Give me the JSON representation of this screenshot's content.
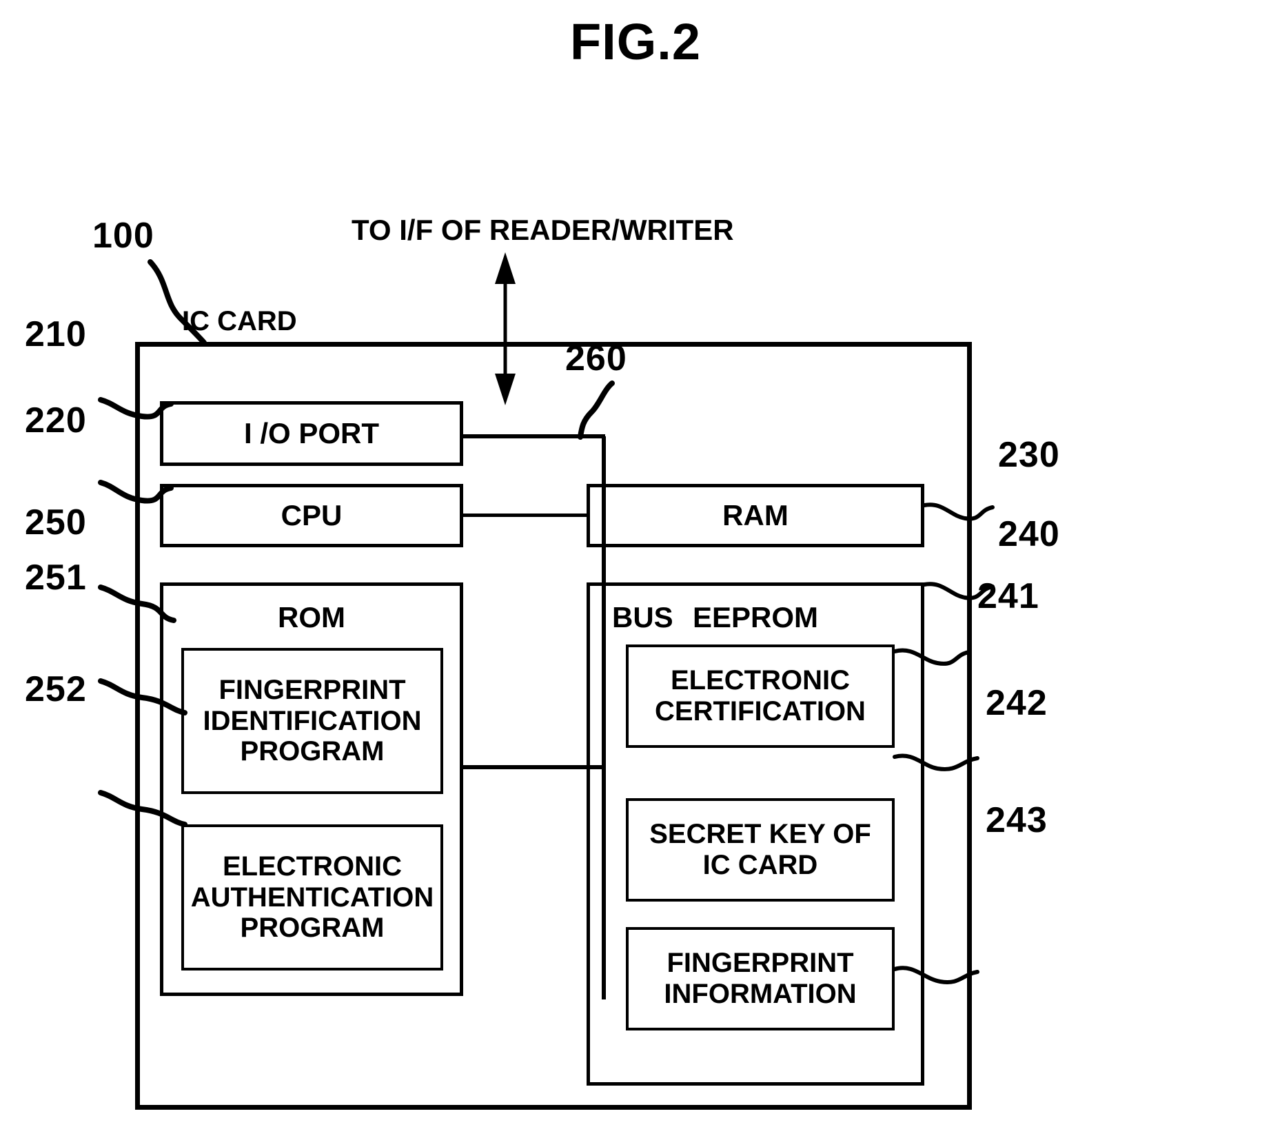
{
  "figure": {
    "title": "FIG.2",
    "top_annotation": "TO  I/F OF READER/WRITER"
  },
  "outer": {
    "label": "IC CARD",
    "ref": "100"
  },
  "bus": {
    "label": "BUS",
    "ref": "260"
  },
  "blocks": {
    "io_port": {
      "label": "I /O PORT",
      "ref": "210"
    },
    "cpu": {
      "label": "CPU",
      "ref": "220"
    },
    "ram": {
      "label": "RAM",
      "ref": "230"
    },
    "rom": {
      "label": "ROM",
      "ref": "250"
    },
    "eeprom": {
      "label": "EEPROM",
      "ref": "240"
    }
  },
  "rom_contents": [
    {
      "label": "FINGERPRINT\nIDENTIFICATION\nPROGRAM",
      "line1": "FINGERPRINT",
      "line2": "IDENTIFICATION",
      "line3": "PROGRAM",
      "ref": "251"
    },
    {
      "label": "ELECTRONIC\nAUTHENTICATION\nPROGRAM",
      "line1": "ELECTRONIC",
      "line2": "AUTHENTICATION",
      "line3": "PROGRAM",
      "ref": "252"
    }
  ],
  "eeprom_contents": [
    {
      "line1": "ELECTRONIC",
      "line2": "CERTIFICATION",
      "ref": "241"
    },
    {
      "line1": "SECRET KEY OF",
      "line2": "IC CARD",
      "ref": "242"
    },
    {
      "line1": "FINGERPRINT",
      "line2": "INFORMATION",
      "ref": "243"
    }
  ],
  "colors": {
    "ink": "#000000",
    "paper": "#ffffff"
  }
}
